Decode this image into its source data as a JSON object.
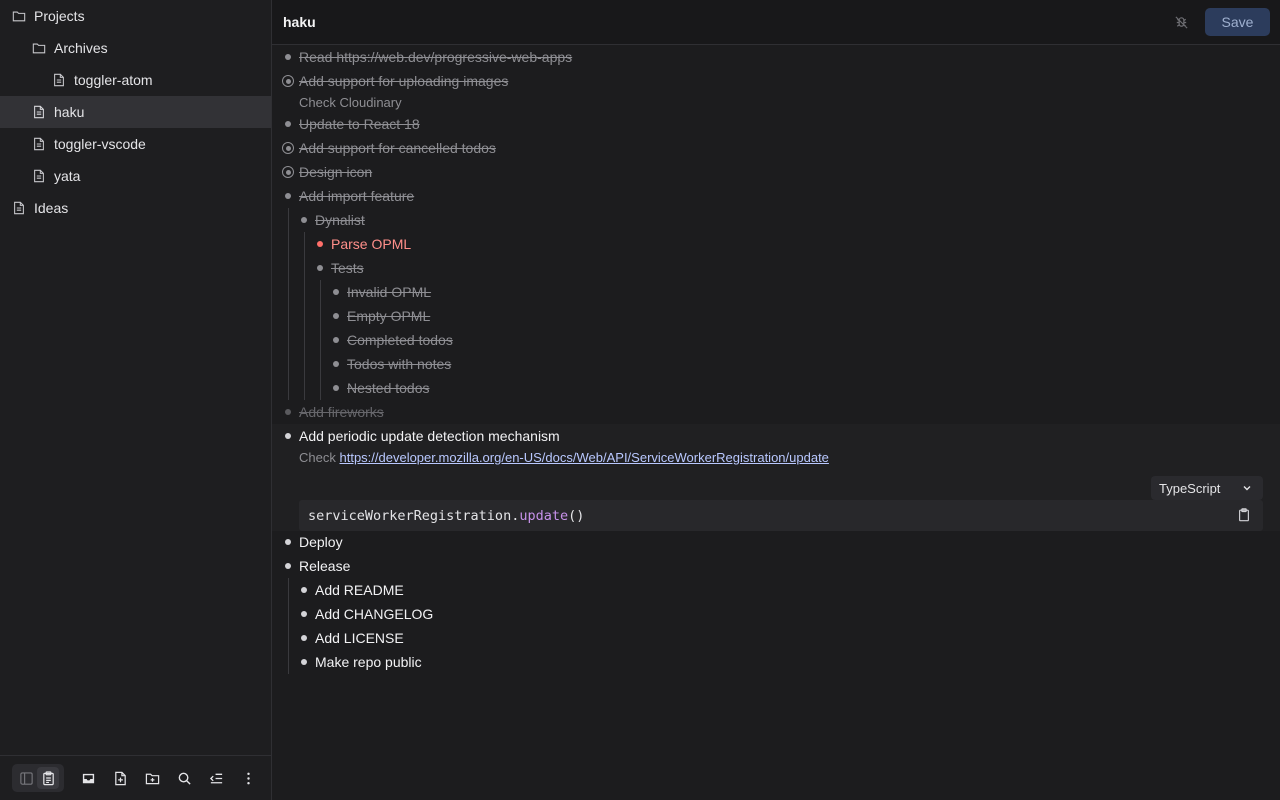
{
  "sidebar": {
    "items": [
      {
        "label": "Projects",
        "icon": "folder-icon"
      },
      {
        "label": "Archives",
        "icon": "folder-icon"
      },
      {
        "label": "toggler-atom",
        "icon": "document-icon"
      },
      {
        "label": "haku",
        "icon": "document-icon",
        "selected": true
      },
      {
        "label": "toggler-vscode",
        "icon": "document-icon"
      },
      {
        "label": "yata",
        "icon": "document-icon"
      },
      {
        "label": "Ideas",
        "icon": "document-icon"
      }
    ],
    "toolbar": [
      "sidebar-panel-icon",
      "todo-clipboard-icon",
      "inbox-icon",
      "new-file-icon",
      "new-folder-icon",
      "search-icon",
      "outdent-list-icon",
      "more-vertical-icon"
    ]
  },
  "header": {
    "title": "haku",
    "save_label": "Save"
  },
  "todos": {
    "t1": "Read https://web.dev/progressive-web-apps",
    "t2": "Add support for uploading images",
    "t2_note": "Check Cloudinary",
    "t3": "Update to React 18",
    "t4": "Add support for cancelled todos",
    "t5": "Design icon",
    "t6": "Add import feature",
    "t7": "Dynalist",
    "t8": "Parse OPML",
    "t9": "Tests",
    "t10": "Invalid OPML",
    "t11": "Empty OPML",
    "t12": "Completed todos",
    "t13": "Todos with notes",
    "t14": "Nested todos",
    "t15": "Add fireworks",
    "t16": "Add periodic update detection mechanism",
    "t16_note_prefix": "Check",
    "t16_note_link": "https://developer.mozilla.org/en-US/docs/Web/API/ServiceWorkerRegistration/update",
    "t17": "Deploy",
    "t18": "Release",
    "t19": "Add README",
    "t20": "Add CHANGELOG",
    "t21": "Add LICENSE",
    "t22": "Make repo public"
  },
  "code_block": {
    "language": "TypeScript",
    "object": "serviceWorkerRegistration.",
    "method": "update",
    "parens": "()"
  },
  "colors": {
    "accent_button": "#2c3c5c",
    "red_todo": "#ff8f8a",
    "link": "#b9c8ff",
    "code_method": "#c792ea"
  }
}
